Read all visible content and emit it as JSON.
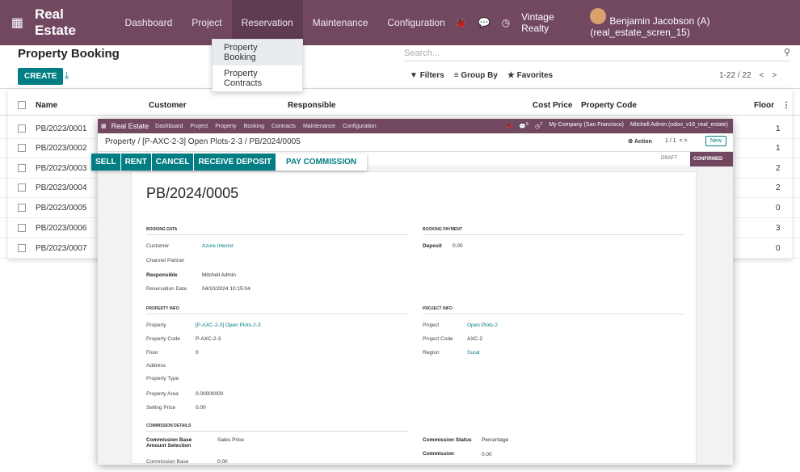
{
  "topbar": {
    "brand": "Real Estate",
    "menu": [
      "Dashboard",
      "Project",
      "Reservation",
      "Maintenance",
      "Configuration"
    ],
    "company": "Vintage Realty",
    "user": "Benjamin Jacobson (A) (real_estate_scren_15)"
  },
  "dropdown": {
    "items": [
      "Property Booking",
      "Property Contracts"
    ]
  },
  "control": {
    "title": "Property Booking",
    "create": "CREATE",
    "search_placeholder": "Search...",
    "filters": "Filters",
    "group_by": "Group By",
    "favorites": "Favorites",
    "pager": "1-22 / 22"
  },
  "list": {
    "headers": [
      "Name",
      "Customer",
      "Responsible",
      "Cost Price",
      "Property Code",
      "Floor"
    ],
    "rows": [
      {
        "name": "PB/2023/0001",
        "floor": "1"
      },
      {
        "name": "PB/2023/0002",
        "floor": "1"
      },
      {
        "name": "PB/2023/0003",
        "floor": "2"
      },
      {
        "name": "PB/2023/0004",
        "floor": "2"
      },
      {
        "name": "PB/2023/0005",
        "floor": "0"
      },
      {
        "name": "PB/2023/0006",
        "floor": "3"
      },
      {
        "name": "PB/2023/0007",
        "floor": "0"
      }
    ]
  },
  "inner": {
    "brand": "Real Estate",
    "menu": [
      "Dashboard",
      "Project",
      "Property",
      "Booking",
      "Contracts",
      "Maintenance",
      "Configuration"
    ],
    "msg_count": "5",
    "activity_count": "7",
    "company": "My Company (San Francisco)",
    "user": "Mitchell Admin (odoo_v16_real_estate)",
    "breadcrumb": "Property / [P-AXC-2-3] Open Plots-2-3 / PB/2024/0005",
    "action": "Action",
    "pager": "1 / 1",
    "new": "New",
    "buttons": [
      "SELL",
      "RENT",
      "CANCEL",
      "RECEIVE DEPOSIT",
      "PAY COMMISSION"
    ],
    "states": [
      "DRAFT",
      "CONFIRMED"
    ],
    "ref": "PB/2024/0005",
    "booking_data": {
      "title": "BOOKING DATA",
      "customer_label": "Customer",
      "customer": "Azure Interior",
      "channel_label": "Channel Partner",
      "responsible_label": "Responsible",
      "responsible": "Mitchell Admin",
      "reservation_label": "Reservation Date",
      "reservation": "04/10/2024 10:15:04"
    },
    "booking_payment": {
      "title": "BOOKING PAYMENT",
      "deposit_label": "Deposit",
      "deposit": "0.00"
    },
    "property_info": {
      "title": "PROPERTY INFO",
      "property_label": "Property",
      "property": "[P-AXC-2-3] Open Plots-2-3",
      "code_label": "Property Code",
      "code": "P-AXC-2-3",
      "floor_label": "Floor",
      "floor": "0",
      "address_label": "Address",
      "type_label": "Property Type",
      "area_label": "Property Area",
      "area": "0.00000000",
      "price_label": "Selling Price",
      "price": "0.00"
    },
    "project_info": {
      "title": "PROJECT INFO",
      "project_label": "Project",
      "project": "Open Plots-2",
      "code_label": "Project Code",
      "code": "AXC-2",
      "region_label": "Region",
      "region": "Surat"
    },
    "commission": {
      "title": "COMMISSION DETAILS",
      "base_amount_label": "Commission Base Amount Selection",
      "base_amount": "Sales Price",
      "base_label": "Commission Base",
      "base": "0.00",
      "status_label": "Commission Status",
      "status": "Percentage",
      "commission_label": "Commission",
      "commission": "0.00"
    }
  }
}
